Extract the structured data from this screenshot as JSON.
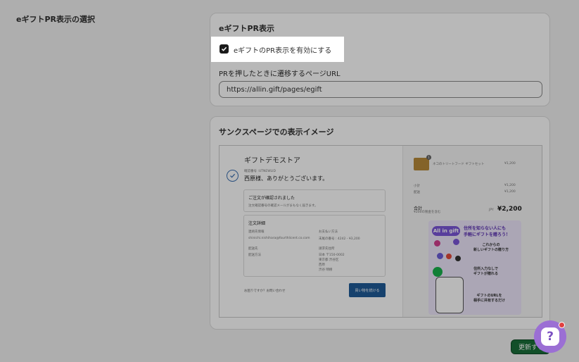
{
  "page": {
    "section_title": "eギフトPR表示の選択"
  },
  "settings_card": {
    "title": "eギフトPR表示",
    "checkbox_label": "eギフトのPR表示を有効にする",
    "checkbox_checked": true,
    "url_label": "PRを押したときに遷移するページURL",
    "url_value": "https://allin.gift/pages/egift"
  },
  "preview_card": {
    "title": "サンクスページでの表示イメージ",
    "preview": {
      "store_name": "ギフトデモストア",
      "order_number": "確認番号 :UTNEWLID",
      "thanks": "西原様、ありがとうございます。",
      "confirm_title": "ご注文が確認されました",
      "confirm_sub": "注文確認番号の確認メールがまもなく届きます。",
      "details_title": "注文詳細",
      "contact_label": "連絡先情報",
      "contact_value": "shinichi.nishihara@fourthlicent.co.com",
      "payment_label": "お支払い方法",
      "payment_value": "末尾の番号 : 4242 - ¥3,200",
      "ship_label": "配送先",
      "ship_lines": [
        "日本 〒150-0002",
        "東京都 渋谷区",
        "西原",
        "渋谷 晴樹"
      ],
      "bill_label": "請求先住所",
      "method_label": "配送方法",
      "help_text": "お困りですか？お問い合わせ",
      "continue_button": "買い物を続ける",
      "item_name": "ネコのトリートフード ギフトセット",
      "item_price": "¥1,200",
      "qty": "1",
      "subtotal_label": "小計",
      "subtotal": "¥1,200",
      "shipping_label": "配送",
      "shipping": "¥1,200",
      "total_label": "合計",
      "tax_note": "¥200の税金を含む",
      "currency": "JPY",
      "total": "¥2,200",
      "banner_logo": "All in gift",
      "banner_head_1": "住所を知らない人にも",
      "banner_head_2": "手軽にギフトを贈ろう！",
      "banner_text_1": "これからの\n新しいギフトの贈り方",
      "banner_text_2": "住所入力なしで\nギフトが贈れる",
      "banner_text_3": "ギフトのURLを\n相手に共有するだけ"
    }
  },
  "footer": {
    "save_label": "更新する"
  },
  "colors": {
    "primary_button": "#1a6e3a",
    "help_fab": "#9b6fd4",
    "accent_blue": "#1f5b98"
  }
}
